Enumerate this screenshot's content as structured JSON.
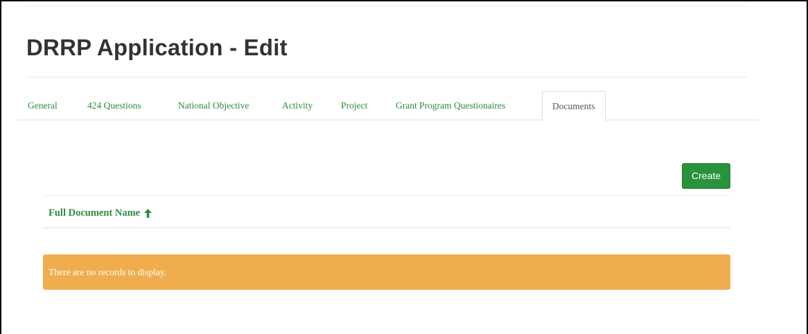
{
  "page": {
    "title": "DRRP Application - Edit"
  },
  "tabs": [
    {
      "label": "General"
    },
    {
      "label": "424 Questions"
    },
    {
      "label": "National Objective"
    },
    {
      "label": "Activity"
    },
    {
      "label": "Project"
    },
    {
      "label": "Grant Program Questionaires"
    },
    {
      "label": "Documents",
      "active": true
    }
  ],
  "toolbar": {
    "create_label": "Create"
  },
  "table": {
    "columns": [
      {
        "header": "Full Document Name",
        "sort": "ascending",
        "sort_icon": "arrow-up-icon"
      }
    ],
    "rows": [],
    "empty_message": "There are no records to display."
  },
  "colors": {
    "accent_green": "#2e8b3e",
    "button_green": "#28923c",
    "warning_orange": "#f0ad4e",
    "title_text": "#333333"
  }
}
